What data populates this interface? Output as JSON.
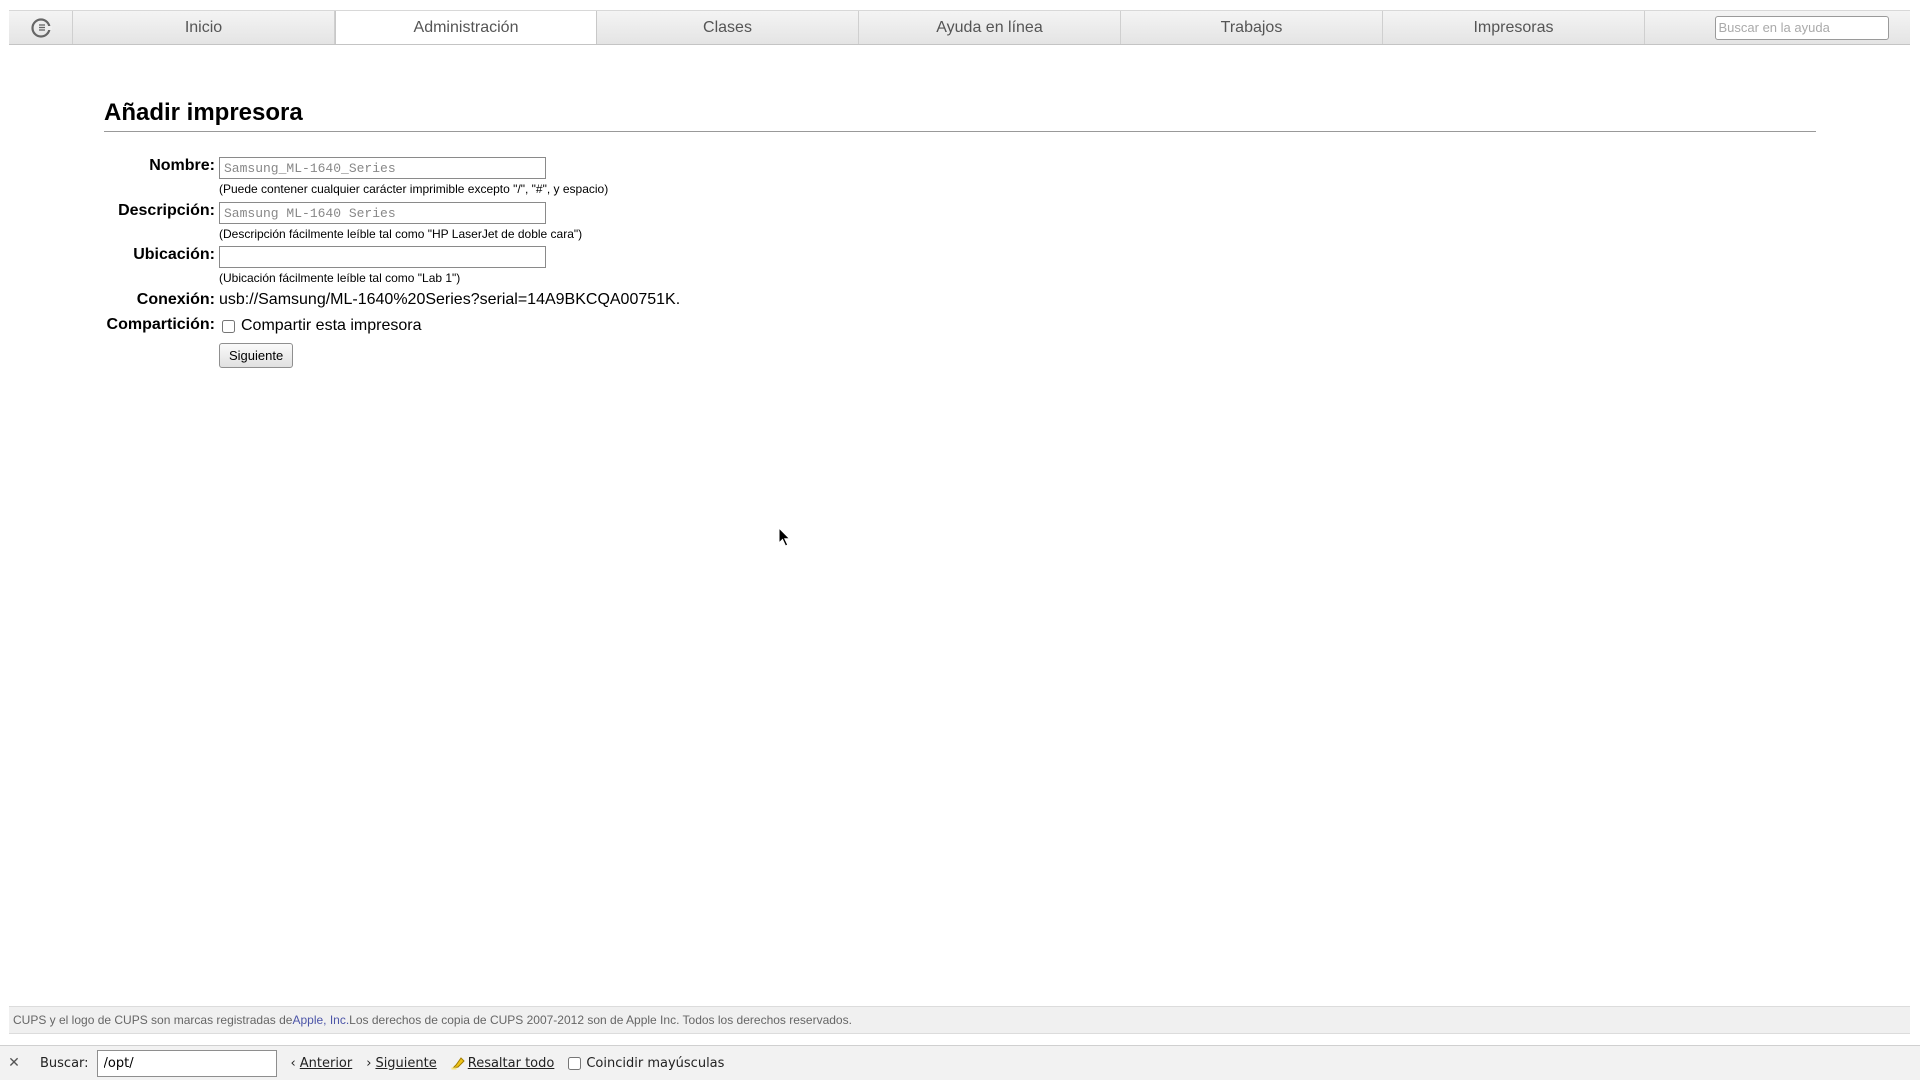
{
  "navbar": {
    "logo_icon": "cups-logo-icon",
    "tabs": [
      {
        "label": "Inicio",
        "active": false
      },
      {
        "label": "Administración",
        "active": true
      },
      {
        "label": "Clases",
        "active": false
      },
      {
        "label": "Ayuda en línea",
        "active": false
      },
      {
        "label": "Trabajos",
        "active": false
      },
      {
        "label": "Impresoras",
        "active": false
      }
    ],
    "search_placeholder": "Buscar en la ayuda"
  },
  "page": {
    "title": "Añadir impresora"
  },
  "form": {
    "name": {
      "label": "Nombre:",
      "value": "",
      "placeholder": "Samsung_ML-1640_Series",
      "hint": "(Puede contener cualquier carácter imprimible excepto \"/\", \"#\", y espacio)"
    },
    "description": {
      "label": "Descripción:",
      "value": "",
      "placeholder": "Samsung ML-1640 Series",
      "hint": "(Descripción fácilmente leíble tal como \"HP LaserJet de doble cara\")"
    },
    "location": {
      "label": "Ubicación:",
      "value": "",
      "placeholder": "",
      "hint": "(Ubicación fácilmente leíble tal como \"Lab 1\")"
    },
    "connection": {
      "label": "Conexión:",
      "value": "usb://Samsung/ML-1640%20Series?serial=14A9BKCQA00751K."
    },
    "sharing": {
      "label": "Compartición:",
      "checkbox_label": "Compartir esta impresora",
      "checked": false
    },
    "next_button_label": "Siguiente"
  },
  "footer": {
    "text_before": "CUPS y el logo de CUPS son marcas registradas de ",
    "link_text": "Apple, Inc.",
    "text_after": " Los derechos de copia de CUPS 2007-2012 son de Apple Inc. Todos los derechos reservados."
  },
  "findbar": {
    "close_icon": "close-icon",
    "label": "Buscar:",
    "value": "/opt/",
    "previous_label": "Anterior",
    "next_label": "Siguiente",
    "highlight_label": "Resaltar todo",
    "match_case_label": "Coincidir mayúsculas"
  }
}
